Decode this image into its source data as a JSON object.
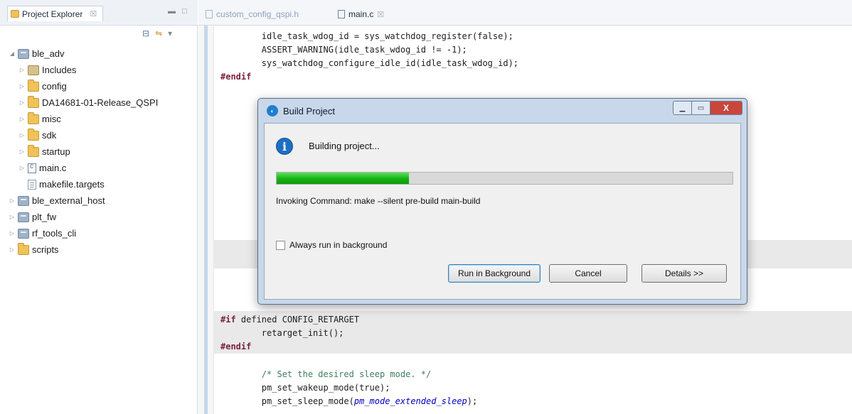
{
  "explorer": {
    "tab_label": "Project Explorer",
    "tab_close": "☒",
    "tree": [
      {
        "label": "ble_adv",
        "level": 0,
        "expanded": true,
        "icon": "project-icon"
      },
      {
        "label": "Includes",
        "level": 1,
        "icon": "includes-icon"
      },
      {
        "label": "config",
        "level": 1,
        "icon": "folder-icon"
      },
      {
        "label": "DA14681-01-Release_QSPI",
        "level": 1,
        "icon": "folder-icon"
      },
      {
        "label": "misc",
        "level": 1,
        "icon": "folder-icon"
      },
      {
        "label": "sdk",
        "level": 1,
        "icon": "folder-icon"
      },
      {
        "label": "startup",
        "level": 1,
        "icon": "folder-icon"
      },
      {
        "label": "main.c",
        "level": 1,
        "icon": "c-file-icon"
      },
      {
        "label": "makefile.targets",
        "level": 1,
        "icon": "file-icon"
      },
      {
        "label": "ble_external_host",
        "level": 0,
        "icon": "project-icon"
      },
      {
        "label": "plt_fw",
        "level": 0,
        "icon": "project-icon"
      },
      {
        "label": "rf_tools_cli",
        "level": 0,
        "icon": "project-icon"
      },
      {
        "label": "scripts",
        "level": 0,
        "icon": "folder-icon"
      }
    ]
  },
  "editor": {
    "tabs": [
      {
        "label": "custom_config_qspi.h",
        "active": false
      },
      {
        "label": "main.c",
        "active": true
      }
    ],
    "code_top": [
      "        idle_task_wdog_id = sys_watchdog_register(false);",
      "        ASSERT_WARNING(idle_task_wdog_id != -1);",
      "        sys_watchdog_configure_idle_id(idle_task_wdog_id);"
    ],
    "endif_1": "#endif",
    "if_kw": "#if",
    "if_rest": " defined CONFIG_RETARGET",
    "retarget": "        retarget_init();",
    "endif_2": "#endif",
    "comment": "        /* Set the desired sleep mode. */",
    "wakeup": "        pm_set_wakeup_mode(true);",
    "sleep_pre": "        pm_set_sleep_mode(",
    "sleep_arg": "pm_mode_extended_sleep",
    "sleep_post": ");"
  },
  "dialog": {
    "title": "Build Project",
    "status": "Building project...",
    "progress": 0.29,
    "progress_color": "#13b313",
    "command": "Invoking Command: make --silent pre-build main-build",
    "checkbox_label": "Always run in background",
    "checkbox_checked": false,
    "buttons": {
      "run_bg": "Run in Background",
      "cancel": "Cancel",
      "details": "Details >>"
    },
    "window_close": "X"
  }
}
